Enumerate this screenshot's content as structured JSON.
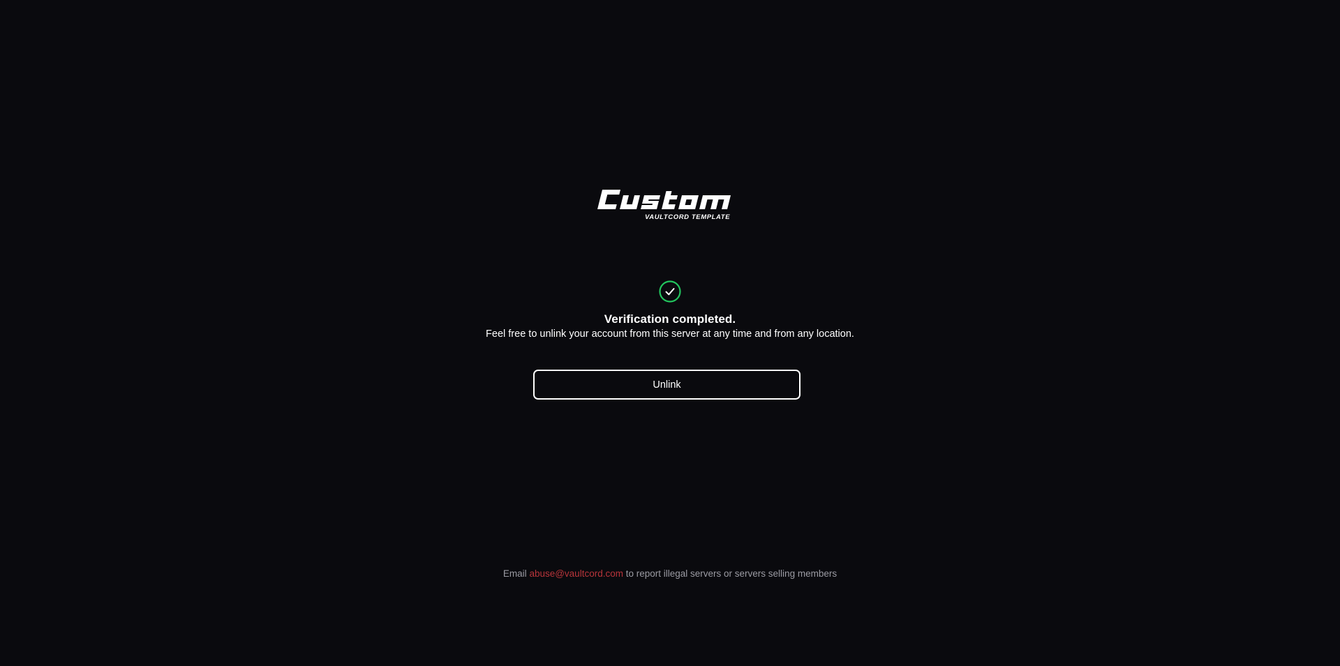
{
  "logo": {
    "wordmark": "Custom",
    "tagline": "VAULTCORD TEMPLATE"
  },
  "status": {
    "icon": "check-circle-icon",
    "icon_color": "#22c55e",
    "title": "Verification completed.",
    "message": "Feel free to unlink your account from this server at any time and from any location."
  },
  "actions": {
    "unlink_label": "Unlink"
  },
  "footer": {
    "prefix": "Email",
    "email": "abuse@vaultcord.com",
    "suffix": "to report illegal servers or servers selling members",
    "link_color": "#b8343a"
  },
  "colors": {
    "background": "#0a0a0e",
    "text": "#ffffff",
    "muted": "#9b9ba3"
  }
}
